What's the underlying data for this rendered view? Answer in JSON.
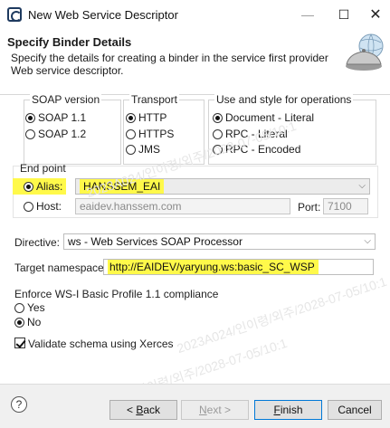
{
  "window": {
    "title": "New Web Service Descriptor",
    "minimize": "—",
    "maximize": "☐",
    "close": "✕"
  },
  "header": {
    "title": "Specify Binder Details",
    "description": "Specify the details for creating a binder in the service first provider Web service descriptor."
  },
  "soap_version": {
    "label": "SOAP version",
    "options": [
      {
        "label": "SOAP 1.1",
        "selected": true
      },
      {
        "label": "SOAP 1.2",
        "selected": false
      }
    ]
  },
  "transport": {
    "label": "Transport",
    "options": [
      {
        "label": "HTTP",
        "selected": true
      },
      {
        "label": "HTTPS",
        "selected": false
      },
      {
        "label": "JMS",
        "selected": false
      }
    ]
  },
  "use_style": {
    "label": "Use and style for operations",
    "options": [
      {
        "label": "Document - Literal",
        "selected": true
      },
      {
        "label": "RPC - Literal",
        "selected": false
      },
      {
        "label": "RPC - Encoded",
        "selected": false
      }
    ]
  },
  "endpoint": {
    "label": "End point",
    "alias_label": "Alias:",
    "alias_value": "HANSSEM_EAI",
    "alias_selected": true,
    "host_label": "Host:",
    "host_value": "eaidev.hanssem.com",
    "host_selected": false,
    "port_label": "Port:",
    "port_value": "7100"
  },
  "directive": {
    "label": "Directive:",
    "value": "ws - Web Services SOAP Processor"
  },
  "target_namespace": {
    "label": "Target namespace:",
    "value": "http://EAIDEV/yaryung.ws:basic_SC_WSP"
  },
  "wsi": {
    "label": "Enforce WS-I Basic Profile 1.1 compliance",
    "options": [
      {
        "label": "Yes",
        "selected": false
      },
      {
        "label": "No",
        "selected": true
      }
    ]
  },
  "validate": {
    "label": "Validate schema using Xerces",
    "checked": true
  },
  "buttons": {
    "help": "?",
    "back_prefix": "< ",
    "back_mnemonic": "B",
    "back_rest": "ack",
    "next_mnemonic": "N",
    "next_rest": "ext >",
    "finish_mnemonic": "F",
    "finish_rest": "inish",
    "cancel": "Cancel"
  },
  "watermarks": [
    "2023A024/인이령/외주/2028-07-05/10:1",
    "2023A024/인이령/외주/2028-07-05/10:1",
    "2023A024/인이령/외주/2028-07-05/10:1"
  ]
}
